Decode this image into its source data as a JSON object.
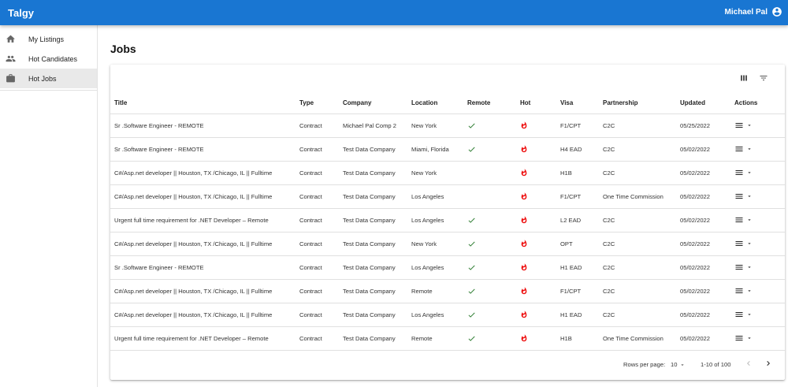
{
  "app": {
    "brand": "Talgy",
    "user_name": "Michael Pal"
  },
  "sidebar": {
    "items": [
      {
        "label": "My Listings",
        "icon": "home-icon",
        "active": false
      },
      {
        "label": "Hot Candidates",
        "icon": "people-icon",
        "active": false
      },
      {
        "label": "Hot Jobs",
        "icon": "briefcase-icon",
        "active": true
      }
    ]
  },
  "page": {
    "title": "Jobs"
  },
  "toolbar": {
    "columns_icon": "view-columns-icon",
    "filter_icon": "filter-list-icon"
  },
  "table": {
    "columns": [
      "Title",
      "Type",
      "Company",
      "Location",
      "Remote",
      "Hot",
      "Visa",
      "Partnership",
      "Updated",
      "Actions"
    ],
    "rows": [
      {
        "title": "Sr .Software Engineer - REMOTE",
        "type": "Contract",
        "company": "Michael Pal Comp 2",
        "location": "New York",
        "remote": true,
        "hot": true,
        "visa": "F1/CPT",
        "partnership": "C2C",
        "updated": "05/25/2022"
      },
      {
        "title": "Sr .Software Engineer - REMOTE",
        "type": "Contract",
        "company": "Test Data Company",
        "location": "Miami, Florida",
        "remote": true,
        "hot": true,
        "visa": "H4 EAD",
        "partnership": "C2C",
        "updated": "05/02/2022"
      },
      {
        "title": "C#/Asp.net developer || Houston, TX /Chicago, IL || Fulltime",
        "type": "Contract",
        "company": "Test Data Company",
        "location": "New York",
        "remote": false,
        "hot": true,
        "visa": "H1B",
        "partnership": "C2C",
        "updated": "05/02/2022"
      },
      {
        "title": "C#/Asp.net developer || Houston, TX /Chicago, IL || Fulltime",
        "type": "Contract",
        "company": "Test Data Company",
        "location": "Los Angeles",
        "remote": false,
        "hot": true,
        "visa": "F1/CPT",
        "partnership": "One Time Commission",
        "updated": "05/02/2022"
      },
      {
        "title": "Urgent full time requirement for .NET Developer – Remote",
        "type": "Contract",
        "company": "Test Data Company",
        "location": "Los Angeles",
        "remote": true,
        "hot": true,
        "visa": "L2 EAD",
        "partnership": "C2C",
        "updated": "05/02/2022"
      },
      {
        "title": "C#/Asp.net developer || Houston, TX /Chicago, IL || Fulltime",
        "type": "Contract",
        "company": "Test Data Company",
        "location": "New York",
        "remote": true,
        "hot": true,
        "visa": "OPT",
        "partnership": "C2C",
        "updated": "05/02/2022"
      },
      {
        "title": "Sr .Software Engineer - REMOTE",
        "type": "Contract",
        "company": "Test Data Company",
        "location": "Los Angeles",
        "remote": true,
        "hot": true,
        "visa": "H1 EAD",
        "partnership": "C2C",
        "updated": "05/02/2022"
      },
      {
        "title": "C#/Asp.net developer || Houston, TX /Chicago, IL || Fulltime",
        "type": "Contract",
        "company": "Test Data Company",
        "location": "Remote",
        "remote": true,
        "hot": true,
        "visa": "F1/CPT",
        "partnership": "C2C",
        "updated": "05/02/2022"
      },
      {
        "title": "C#/Asp.net developer || Houston, TX /Chicago, IL || Fulltime",
        "type": "Contract",
        "company": "Test Data Company",
        "location": "Los Angeles",
        "remote": true,
        "hot": true,
        "visa": "H1 EAD",
        "partnership": "C2C",
        "updated": "05/02/2022"
      },
      {
        "title": "Urgent full time requirement for .NET Developer – Remote",
        "type": "Contract",
        "company": "Test Data Company",
        "location": "Remote",
        "remote": true,
        "hot": true,
        "visa": "H1B",
        "partnership": "One Time Commission",
        "updated": "05/02/2022"
      }
    ]
  },
  "pagination": {
    "rows_per_page_label": "Rows per page:",
    "rows_per_page": "10",
    "range": "1-10 of 100"
  },
  "colors": {
    "appbar": "#1976d2",
    "remote_check": "#2e7d32",
    "hot_fire": "#ee1111"
  }
}
